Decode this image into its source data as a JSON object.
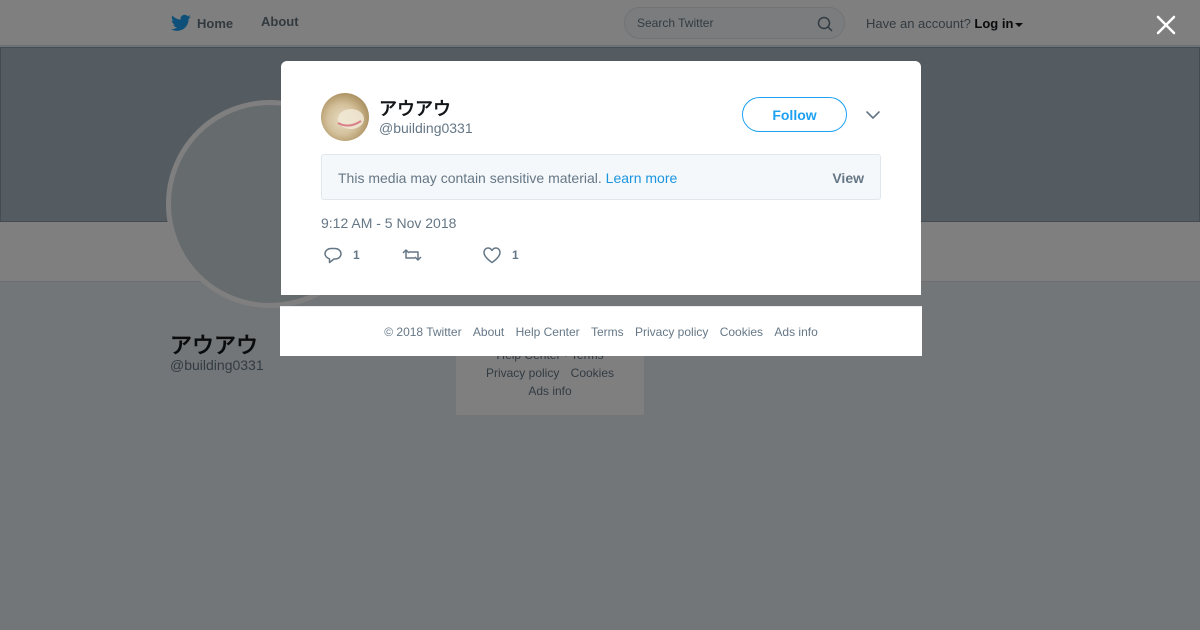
{
  "topbar": {
    "home_label": "Home",
    "about_label": "About",
    "search_placeholder": "Search Twitter",
    "account_prompt": "Have an account?",
    "login_label": "Log in"
  },
  "profile": {
    "name": "アウアウ",
    "handle": "@building0331"
  },
  "background_footer": {
    "row1": "Help Center · Terms",
    "row2_a": "Privacy policy",
    "row2_b": "Cookies",
    "row3": "Ads info"
  },
  "tweet": {
    "author_name": "アウアウ",
    "author_handle": "@building0331",
    "follow_label": "Follow",
    "sensitive_notice": "This media may contain sensitive material.",
    "learn_more_label": "Learn more",
    "view_label": "View",
    "timestamp": "9:12 AM - 5 Nov 2018",
    "reply_count": "1",
    "retweet_count": "",
    "like_count": "1"
  },
  "modal_footer": {
    "copyright": "© 2018 Twitter",
    "links": [
      "About",
      "Help Center",
      "Terms",
      "Privacy policy",
      "Cookies",
      "Ads info"
    ]
  },
  "colors": {
    "accent": "#1da1f2",
    "link": "#1b95e0",
    "muted_text": "#657786",
    "overlay": "rgba(0,0,0,0.5)"
  },
  "icons": [
    "twitter-bird-icon",
    "search-icon",
    "caret-down-icon",
    "close-icon",
    "chevron-down-icon",
    "reply-icon",
    "retweet-icon",
    "like-icon"
  ]
}
